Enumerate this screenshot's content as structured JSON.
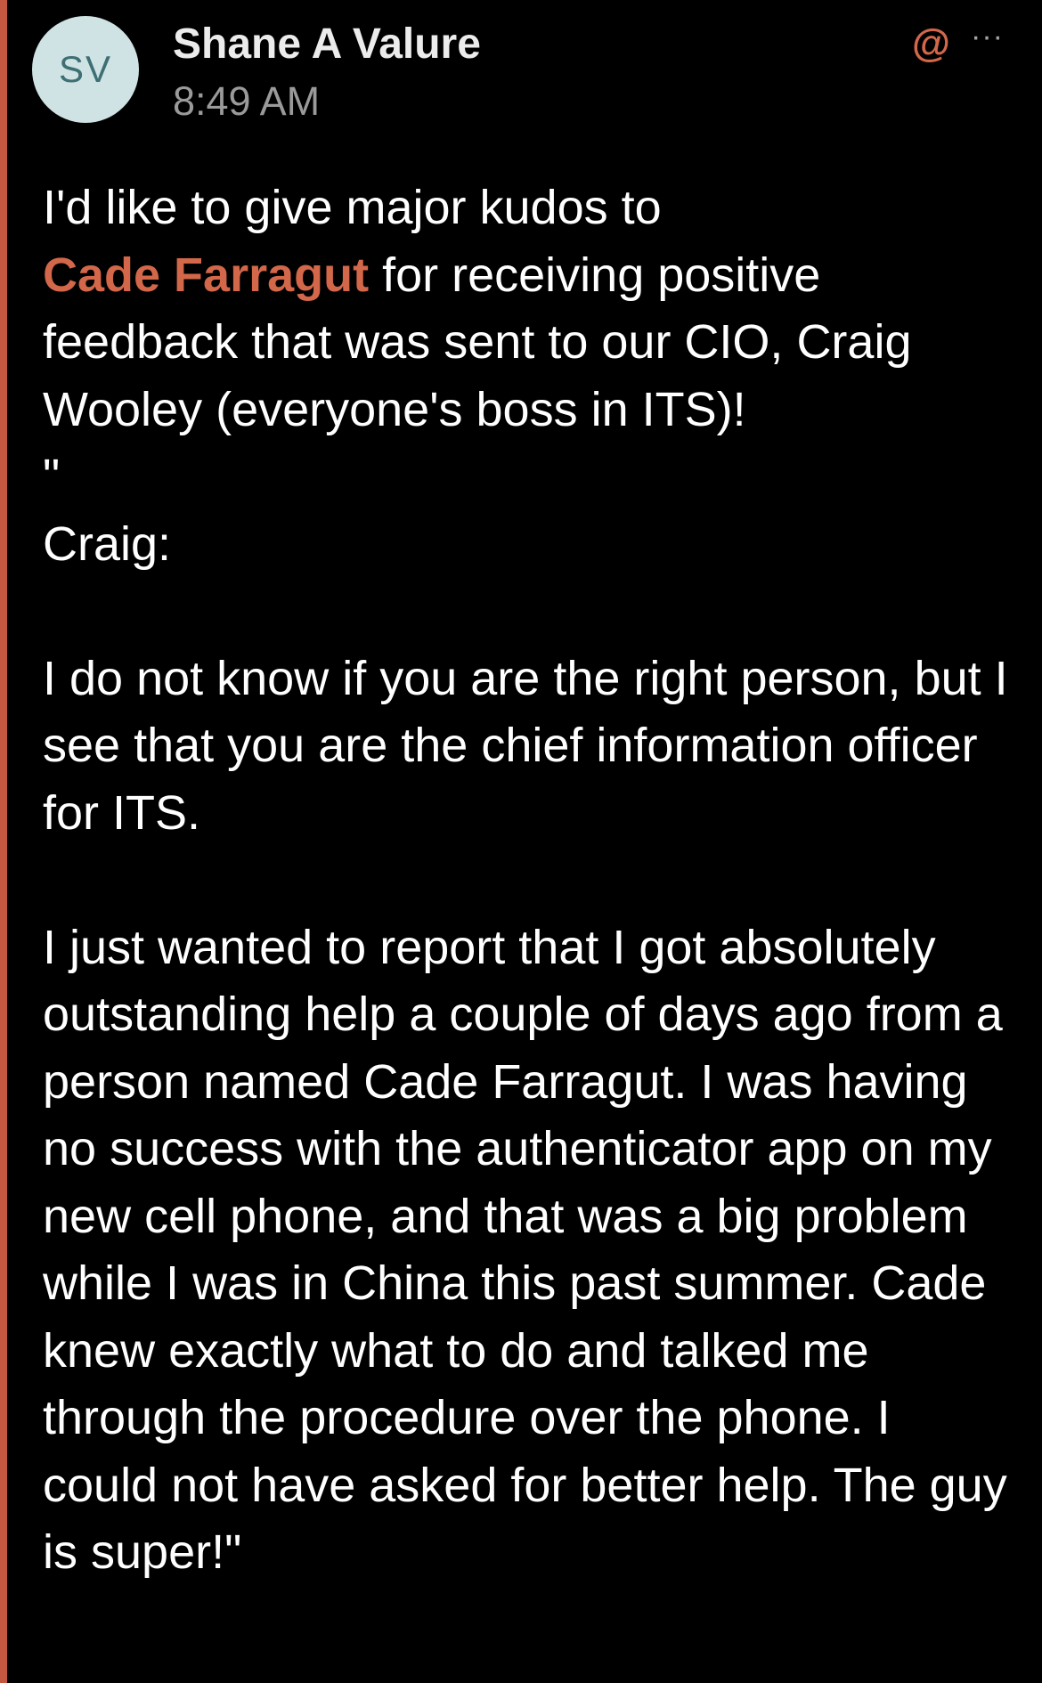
{
  "post": {
    "author_initials": "SV",
    "author_name": "Shane A Valure",
    "time": "8:49 AM",
    "mention_icon_glyph": "@",
    "more_icon_glyph": "···",
    "message": {
      "intro_before": "I'd like to give major kudos to",
      "mention_name": "Cade Farragut",
      "intro_after": " for receiving positive feedback that was sent to our CIO, Craig Wooley (everyone's boss in ITS)!",
      "open_quote": "\"",
      "greeting": "Craig:",
      "paragraph_1": "I do not know if you are the right person, but I see that you are the chief information officer for ITS.",
      "paragraph_2": "I just wanted to report that I got absolutely outstanding help a couple of days ago from a person named Cade Farragut. I was having no success with the authenticator app on my new cell phone, and that was a big problem while I was in China this past summer. Cade knew exactly what to do and talked me through the procedure over the phone. I could not have asked for better help. The guy is super!\""
    }
  },
  "colors": {
    "background": "#000000",
    "accent_bar": "#c4573f",
    "mention": "#d2674a",
    "timestamp": "#9a9a9a",
    "avatar_bg": "#cfe3e4",
    "avatar_text": "#3e6f74"
  },
  "icons": {
    "mention": "at-sign-icon",
    "more": "ellipsis-icon"
  }
}
